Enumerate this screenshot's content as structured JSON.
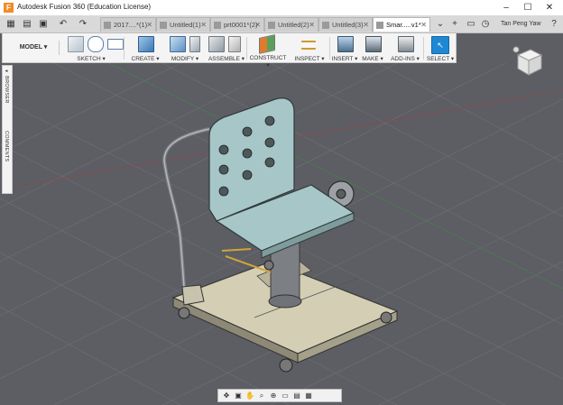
{
  "window": {
    "title": "Autodesk Fusion 360 (Education License)",
    "logo": "F",
    "minimize": "–",
    "maximize": "☐",
    "close": "✕"
  },
  "tabbar": {
    "tabs": [
      {
        "label": "2017....*(1)",
        "active": false
      },
      {
        "label": "Untitled(1)",
        "active": false
      },
      {
        "label": "prt0001*(2)",
        "active": false
      },
      {
        "label": "Untitled(2)",
        "active": false
      },
      {
        "label": "Untitled(3)",
        "active": false
      },
      {
        "label": "Smar.....v1*",
        "active": true
      }
    ],
    "user_name": "Tan Peng Yaw"
  },
  "toolbar": {
    "workspace": "MODEL ▾",
    "groups": [
      {
        "label": "SKETCH ▾"
      },
      {
        "label": "CREATE ▾"
      },
      {
        "label": "MODIFY ▾"
      },
      {
        "label": "ASSEMBLE ▾"
      },
      {
        "label": "CONSTRUCT ▾"
      },
      {
        "label": "INSPECT ▾"
      },
      {
        "label": "INSERT ▾"
      },
      {
        "label": "MAKE ▾"
      },
      {
        "label": "ADD-INS ▾"
      },
      {
        "label": "SELECT ▾"
      }
    ]
  },
  "panels": {
    "browser": "BROWSER",
    "comments": "COMMENTS"
  },
  "colors": {
    "accent_select": "#1e88d4",
    "viewport_bg": "#5c5e63",
    "grid": "#6c6e73",
    "seat_blue": "#a7c6c7",
    "base_board": "#d4cfb4"
  }
}
